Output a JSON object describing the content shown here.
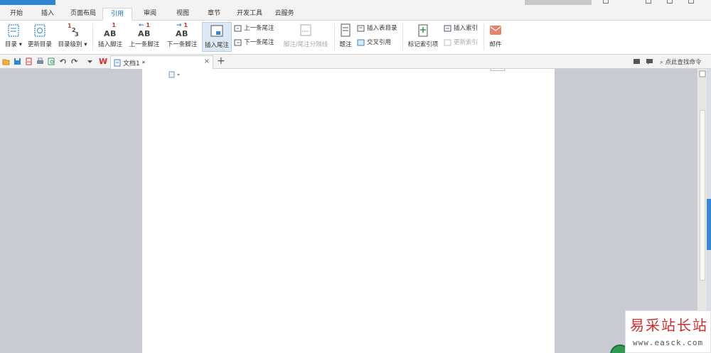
{
  "tabs": [
    {
      "label": "开始",
      "active": false
    },
    {
      "label": "插入",
      "active": false
    },
    {
      "label": "页面布局",
      "active": false
    },
    {
      "label": "引用",
      "active": true
    },
    {
      "label": "审阅",
      "active": false
    },
    {
      "label": "视图",
      "active": false
    },
    {
      "label": "章节",
      "active": false
    },
    {
      "label": "开发工具",
      "active": false
    },
    {
      "label": "云服务",
      "active": false
    }
  ],
  "ribbon": {
    "toc": "目录",
    "update_toc": "更新目录",
    "toc_level": "目录级别",
    "insert_footnote": "插入脚注",
    "prev_footnote": "上一条脚注",
    "next_footnote": "下一条脚注",
    "insert_endnote": "插入尾注",
    "prev_endnote": "上一条尾注",
    "next_endnote": "下一条尾注",
    "separator_line": "脚注/尾注分隔线",
    "caption": "题注",
    "insert_table_of_figures": "插入表目录",
    "cross_reference": "交叉引用",
    "mark_index_entry": "标记索引项",
    "insert_index": "插入索引",
    "update_index": "更新索引",
    "mail": "邮件",
    "icon_toc_num1": "1",
    "icon_toc_num2": "2",
    "icon_toc_num3": "3",
    "ab_text": "AB",
    "sup_1": "1"
  },
  "docbar": {
    "doc_tab": "文档1 *",
    "close": "×",
    "add": "+",
    "wps_logo": "W",
    "find_command": "点此查找命令"
  },
  "watermark": {
    "line1": "易采站长站",
    "line2": "www.easck.com"
  },
  "colors": {
    "accent": "#2f86d4",
    "active_tab_text": "#1d72c8",
    "mail_icon": "#e8826a",
    "wps_red": "#d42a2a"
  }
}
